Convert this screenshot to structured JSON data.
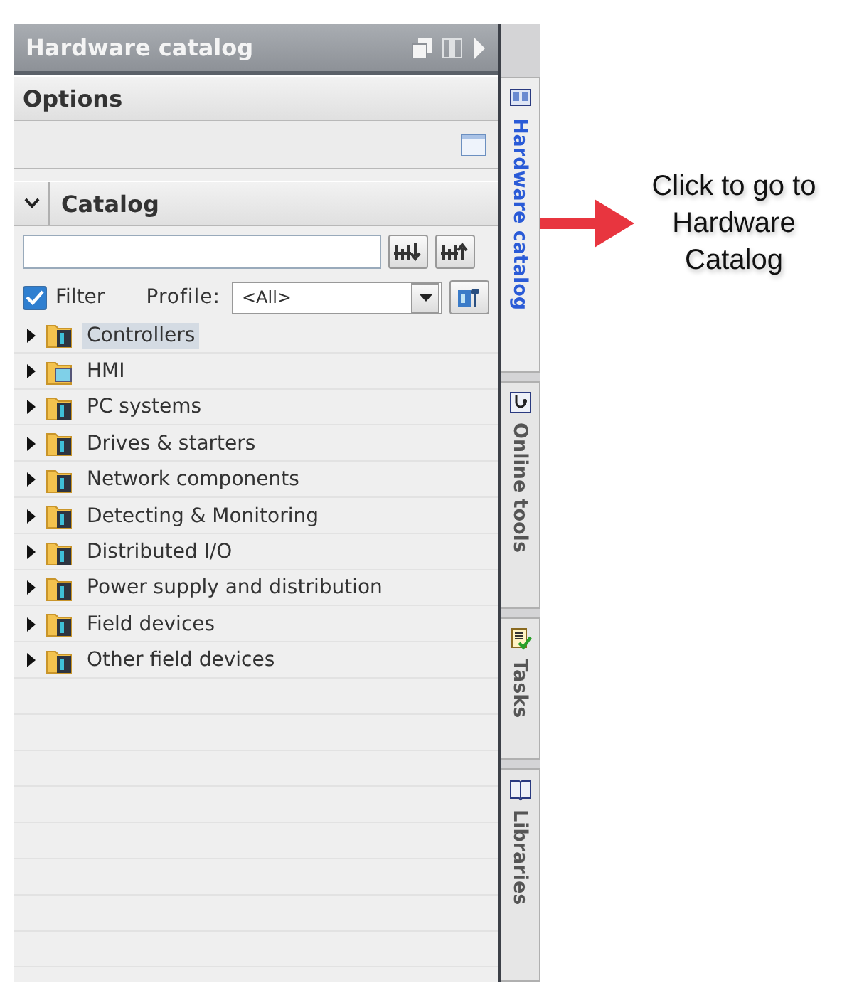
{
  "panel": {
    "title": "Hardware catalog"
  },
  "options": {
    "title": "Options"
  },
  "catalog": {
    "title": "Catalog",
    "expanded": true,
    "filter": {
      "label": "Filter",
      "checked": true
    },
    "profile": {
      "label": "Profile:",
      "value": "<All>"
    },
    "items": [
      {
        "label": "Controllers",
        "kind": "device",
        "expanded": false,
        "selected": true
      },
      {
        "label": "HMI",
        "kind": "hmi",
        "expanded": false,
        "selected": false
      },
      {
        "label": "PC systems",
        "kind": "device",
        "expanded": false,
        "selected": false
      },
      {
        "label": "Drives & starters",
        "kind": "device",
        "expanded": false,
        "selected": false
      },
      {
        "label": "Network components",
        "kind": "device",
        "expanded": false,
        "selected": false
      },
      {
        "label": "Detecting & Monitoring",
        "kind": "device",
        "expanded": false,
        "selected": false
      },
      {
        "label": "Distributed I/O",
        "kind": "device",
        "expanded": false,
        "selected": false
      },
      {
        "label": "Power supply and distribution",
        "kind": "device",
        "expanded": false,
        "selected": false
      },
      {
        "label": "Field devices",
        "kind": "device",
        "expanded": false,
        "selected": false
      },
      {
        "label": "Other field devices",
        "kind": "device",
        "expanded": false,
        "selected": false
      }
    ]
  },
  "side_tabs": [
    {
      "label": "Hardware catalog",
      "kind": "catalog",
      "selected": true
    },
    {
      "label": "Online tools",
      "kind": "online",
      "selected": false
    },
    {
      "label": "Tasks",
      "kind": "tasks",
      "selected": false
    },
    {
      "label": "Libraries",
      "kind": "libraries",
      "selected": false
    }
  ],
  "annotation": {
    "text": "Click to go to Hardware Catalog"
  }
}
